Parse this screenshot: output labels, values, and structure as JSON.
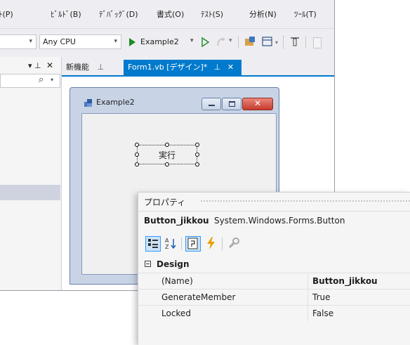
{
  "menu": {
    "items": [
      {
        "label": "ﾄ(P)"
      },
      {
        "label": "ﾋﾞﾙﾄﾞ(B)"
      },
      {
        "label": "ﾃﾞﾊﾞｯｸﾞ(D)"
      },
      {
        "label": "書式(O)"
      },
      {
        "label": "ﾃｽﾄ(S)"
      },
      {
        "label": "分析(N)"
      },
      {
        "label": "ﾂｰﾙ(T)"
      }
    ]
  },
  "toolbar": {
    "platform": "Any CPU",
    "run_label": "Example2"
  },
  "solution_panel": {
    "pin": "▾ ⊥",
    "close": "✕",
    "search_icon": "⌕"
  },
  "tabs": [
    {
      "label": "新機能",
      "pin": "⊥",
      "active": false
    },
    {
      "label": "Form1.vb [デザイン]*",
      "pin": "⊥",
      "close": "✕",
      "active": true
    }
  ],
  "form_designer": {
    "window_title": "Example2",
    "button_label": "実行"
  },
  "properties": {
    "title": "プロパティ",
    "selected_object": "Button_jikkou",
    "selected_type": "System.Windows.Forms.Button",
    "category": "Design",
    "rows": [
      {
        "name": "(Name)",
        "value": "Button_jikkou",
        "bold": true
      },
      {
        "name": "GenerateMember",
        "value": "True",
        "bold": false
      },
      {
        "name": "Locked",
        "value": "False",
        "bold": false
      }
    ]
  },
  "colors": {
    "accent": "#007acc",
    "run_green": "#1e8a24",
    "close_red": "#c64545",
    "lightning": "#e8a000"
  }
}
